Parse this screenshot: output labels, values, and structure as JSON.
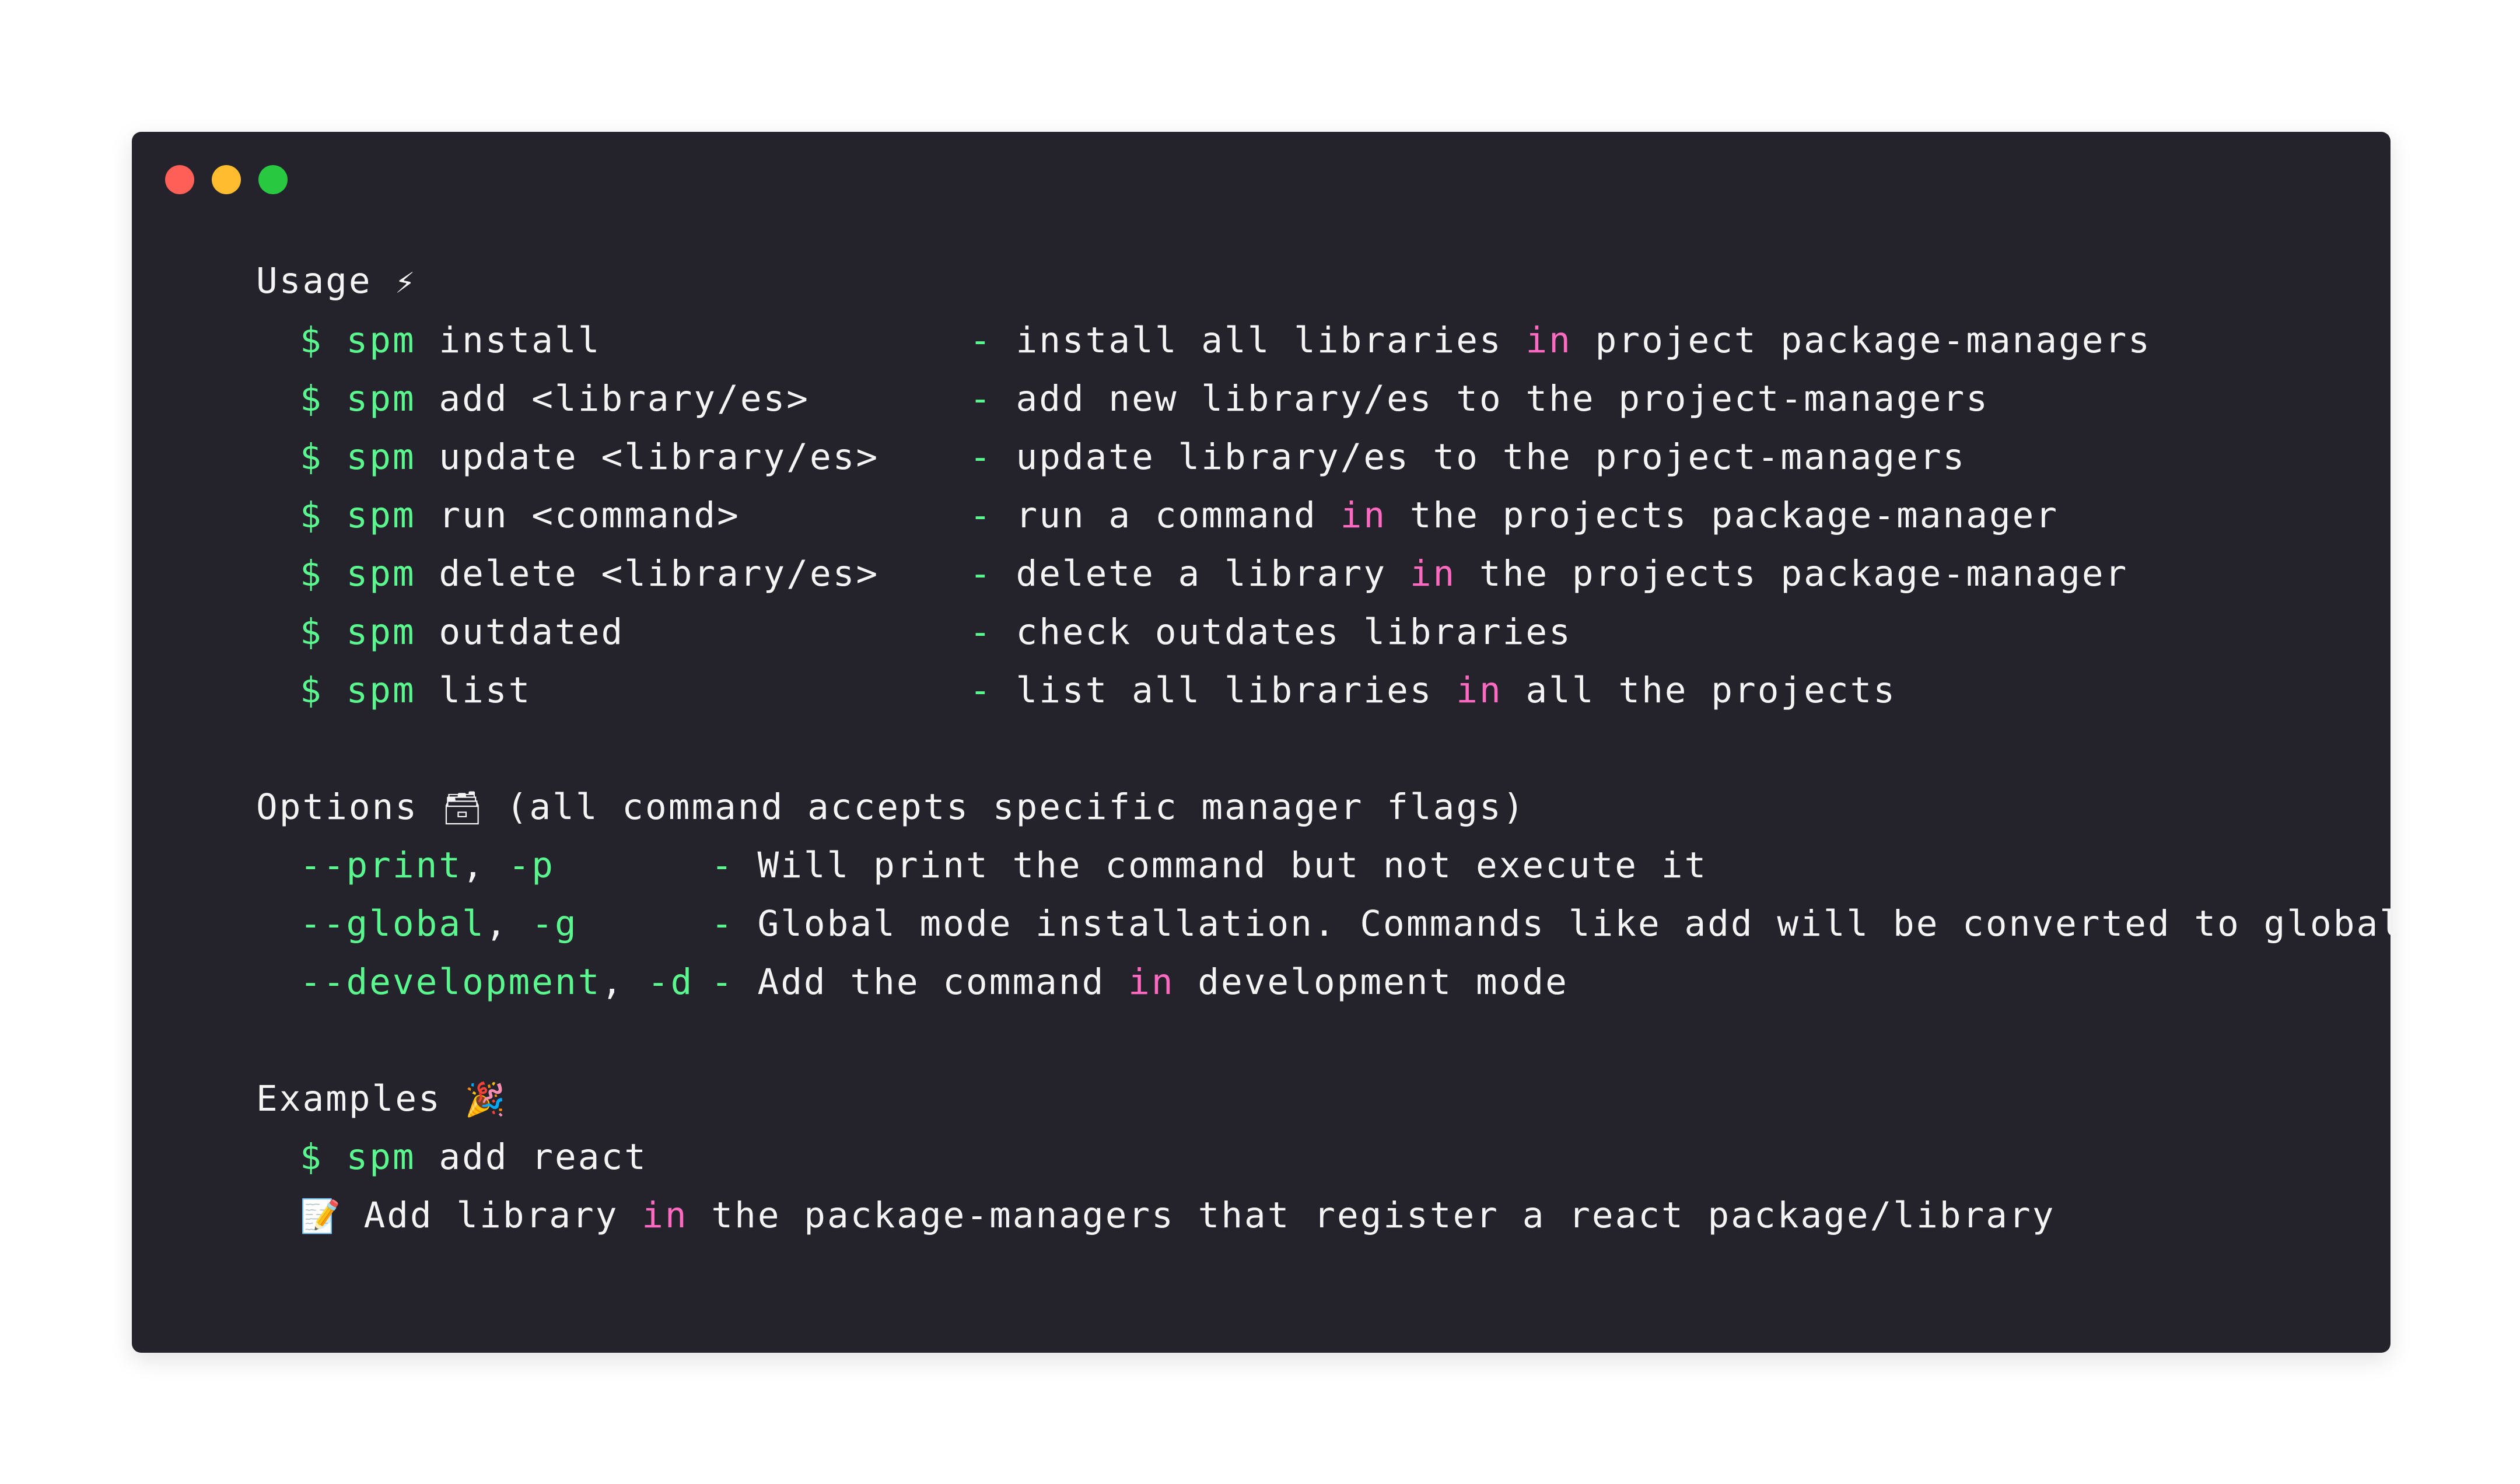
{
  "window": {
    "controls": [
      "close",
      "minimize",
      "maximize"
    ]
  },
  "usage": {
    "heading": "Usage",
    "heading_icon": "⚡",
    "commands": [
      {
        "prompt": "$",
        "cmd": "spm",
        "args": "install",
        "sep": "-",
        "desc_a": "install all libraries",
        "kw": "in",
        "desc_b": "project package-managers"
      },
      {
        "prompt": "$",
        "cmd": "spm",
        "args": "add <library/es>",
        "sep": "-",
        "desc_a": "add new library/es to the project-managers",
        "kw": "",
        "desc_b": ""
      },
      {
        "prompt": "$",
        "cmd": "spm",
        "args": "update <library/es>",
        "sep": "-",
        "desc_a": "update library/es to the project-managers",
        "kw": "",
        "desc_b": ""
      },
      {
        "prompt": "$",
        "cmd": "spm",
        "args": "run <command>",
        "sep": "-",
        "desc_a": "run a command",
        "kw": "in",
        "desc_b": "the projects package-manager"
      },
      {
        "prompt": "$",
        "cmd": "spm",
        "args": "delete <library/es>",
        "sep": "-",
        "desc_a": "delete a library",
        "kw": "in",
        "desc_b": "the projects package-manager"
      },
      {
        "prompt": "$",
        "cmd": "spm",
        "args": "outdated",
        "sep": "-",
        "desc_a": "check outdates libraries",
        "kw": "",
        "desc_b": ""
      },
      {
        "prompt": "$",
        "cmd": "spm",
        "args": "list",
        "sep": "-",
        "desc_a": "list all libraries",
        "kw": "in",
        "desc_b": "all the projects"
      }
    ]
  },
  "options": {
    "heading": "Options",
    "heading_icon": "🗃",
    "heading_note": "(all command accepts specific manager flags)",
    "flags": [
      {
        "long": "--print",
        "comma": ",",
        "short": "-p",
        "sep": "-",
        "desc_a": "Will print the command but not execute it",
        "kw": "",
        "desc_b": ""
      },
      {
        "long": "--global",
        "comma": ",",
        "short": "-g",
        "sep": "-",
        "desc_a": "Global mode installation. Commands like add will be converted to global",
        "kw": "",
        "desc_b": ""
      },
      {
        "long": "--development",
        "comma": ",",
        "short": "-d",
        "sep": "-",
        "desc_a": "Add the command",
        "kw": "in",
        "desc_b": "development mode"
      }
    ]
  },
  "examples": {
    "heading": "Examples",
    "heading_icon": "🎉",
    "command": {
      "prompt": "$",
      "cmd": "spm",
      "args": "add react"
    },
    "note_icon": "📝",
    "note_a": "Add library",
    "note_kw": "in",
    "note_b": "the package-managers that register a react package/library"
  },
  "colors": {
    "background": "#24232c",
    "text": "#f4f4f5",
    "command": "#5af78e",
    "keyword": "#ff6ac1"
  }
}
